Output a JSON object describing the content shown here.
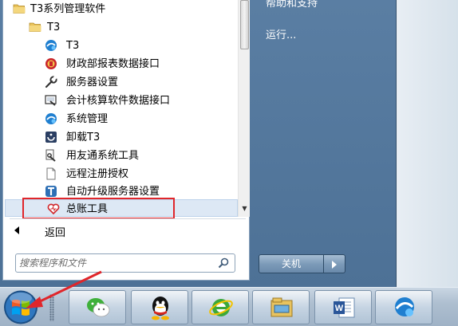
{
  "start_menu": {
    "programs": [
      {
        "label": "T3系列管理软件",
        "icon": "folder-icon"
      },
      {
        "label": "T3",
        "icon": "folder-icon"
      },
      {
        "label": "T3",
        "icon": "t3-app-icon"
      },
      {
        "label": "财政部报表数据接口",
        "icon": "finance-report-icon"
      },
      {
        "label": "服务器设置",
        "icon": "wrench-icon"
      },
      {
        "label": "会计核算软件数据接口",
        "icon": "accounting-interface-icon"
      },
      {
        "label": "系统管理",
        "icon": "t3-app-icon"
      },
      {
        "label": "卸载T3",
        "icon": "uninstall-icon"
      },
      {
        "label": "用友通系统工具",
        "icon": "tools-icon"
      },
      {
        "label": "远程注册授权",
        "icon": "document-icon"
      },
      {
        "label": "自动升级服务器设置",
        "icon": "update-icon"
      },
      {
        "label": "总账工具",
        "icon": "ledger-tool-icon",
        "selected": true
      }
    ],
    "back_label": "返回",
    "search": {
      "placeholder": "搜索程序和文件"
    },
    "right_links": {
      "help": "帮助和支持",
      "run": "运行..."
    },
    "shutdown_label": "关机"
  },
  "taskbar": {
    "pinned": [
      {
        "name": "wechat-icon"
      },
      {
        "name": "qq-icon"
      },
      {
        "name": "internet-explorer-icon"
      },
      {
        "name": "file-explorer-icon"
      },
      {
        "name": "word-icon"
      },
      {
        "name": "t3-taskbar-icon"
      }
    ]
  },
  "colors": {
    "start_menu_bg": "#4f7398",
    "highlight_box": "#e0262b",
    "selection_bg": "#dde8f5"
  }
}
